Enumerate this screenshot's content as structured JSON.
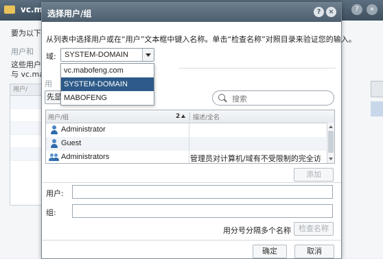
{
  "background": {
    "title": "vc.ma",
    "lines": [
      "要为以下",
      "用户和",
      "这些用户",
      "与 vc.mab"
    ],
    "table_header": "用户/"
  },
  "dialog": {
    "title": "选择用户/组",
    "help_button": "?",
    "close_button": "×",
    "instruction": "从列表中选择用户或在“用户”文本框中键入名称。单击“检查名称”对照目录来验证您的输入。",
    "domain_label": "域:",
    "domain_selected": "SYSTEM-DOMAIN",
    "domain_options": [
      "vc.mabofeng.com",
      "SYSTEM-DOMAIN",
      "MABOFENG"
    ],
    "hidden_label": "用",
    "show_first_label": "先显",
    "search_placeholder": "搜索",
    "table": {
      "col_name": "用户/组",
      "sort_indicator": "2",
      "col_desc": "描述/全名",
      "rows": [
        {
          "name": "Administrator",
          "desc": "",
          "type": "user"
        },
        {
          "name": "Guest",
          "desc": "",
          "type": "user"
        },
        {
          "name": "Administrators",
          "desc": "管理员对计算机/域有不受限制的完全访...",
          "type": "group"
        }
      ]
    },
    "add_button": "添加",
    "users_label": "用户:",
    "groups_label": "组:",
    "users_value": "",
    "groups_value": "",
    "separator_hint": "用分号分隔多个名称",
    "check_names_button": "检查名称",
    "ok_button": "确定",
    "cancel_button": "取消"
  },
  "colors": {
    "titlebar": "#4d5f6e",
    "selected_option": "#2d5a88",
    "user_icon": "#2f6aa8"
  }
}
